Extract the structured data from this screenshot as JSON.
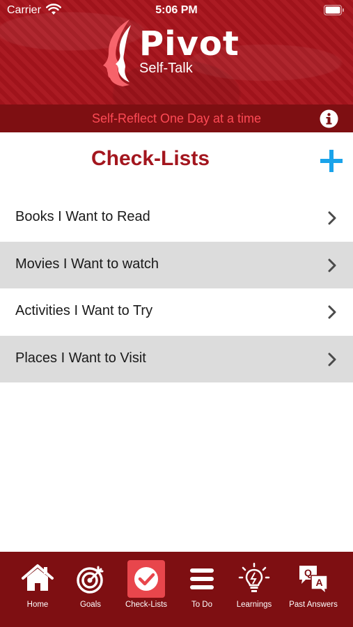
{
  "status_bar": {
    "carrier": "Carrier",
    "time": "5:06 PM"
  },
  "header": {
    "logo_title": "Pivot",
    "logo_subtitle": "Self-Talk",
    "tagline": "Self-Reflect One Day at a time",
    "info_icon": "info-icon"
  },
  "page": {
    "title": "Check-Lists",
    "add_icon": "plus-icon"
  },
  "lists": [
    {
      "label": "Books I Want to Read"
    },
    {
      "label": "Movies I Want to watch"
    },
    {
      "label": "Activities I Want to Try"
    },
    {
      "label": "Places I Want to Visit"
    }
  ],
  "tabs": [
    {
      "label": "Home",
      "icon": "home-icon"
    },
    {
      "label": "Goals",
      "icon": "target-icon"
    },
    {
      "label": "Check-Lists",
      "icon": "checkmark-icon",
      "active": true
    },
    {
      "label": "To Do",
      "icon": "menu-lines-icon"
    },
    {
      "label": "Learnings",
      "icon": "lightbulb-icon"
    },
    {
      "label": "Past Answers",
      "icon": "qa-icon"
    }
  ],
  "colors": {
    "brand_red": "#a8141c",
    "dark_red": "#7e0f12",
    "tagline_red": "#ff4a55",
    "title_red": "#a3161e",
    "accent_blue": "#1aa3ea",
    "active_tab": "#e8464c",
    "row_alt": "#dcdcdc"
  }
}
